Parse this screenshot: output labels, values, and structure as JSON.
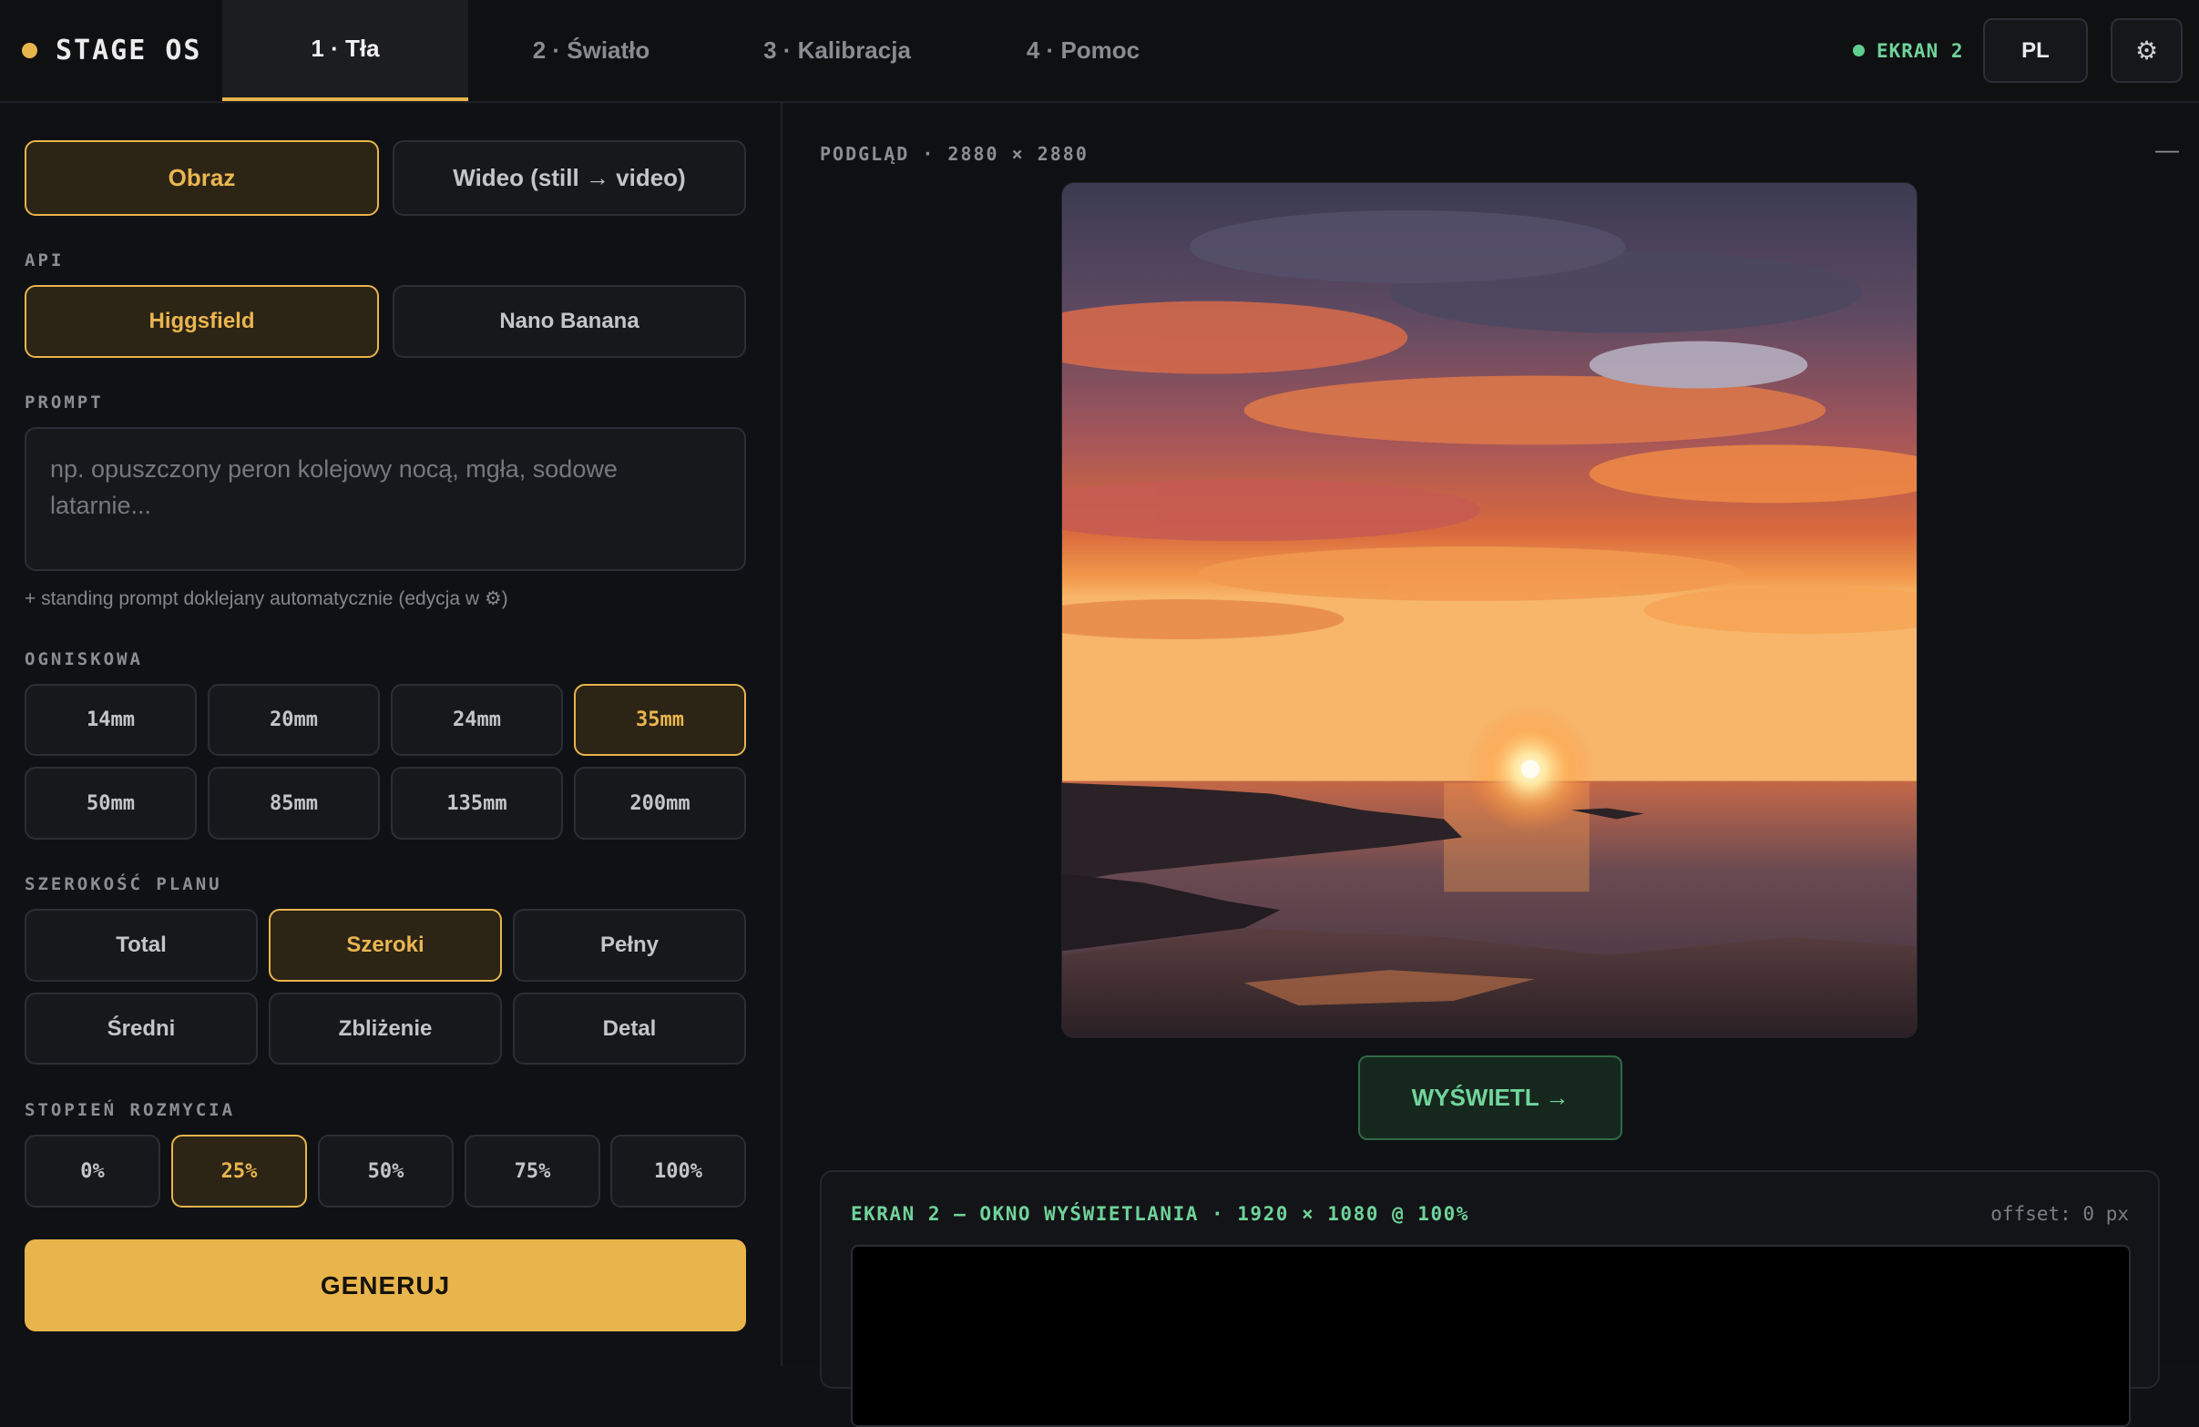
{
  "app": {
    "name": "STAGE OS"
  },
  "tabs": [
    {
      "label": "1 · Tła"
    },
    {
      "label": "2 · Światło"
    },
    {
      "label": "3 · Kalibracja"
    },
    {
      "label": "4 · Pomoc"
    }
  ],
  "status": {
    "screen_label": "EKRAN 2",
    "language": "PL"
  },
  "source": {
    "image_label": "Obraz",
    "video_label": "Wideo (still → video)",
    "selected": "Obraz"
  },
  "api": {
    "label": "API",
    "options": [
      "Higgsfield",
      "Nano Banana"
    ],
    "selected": "Higgsfield"
  },
  "prompt": {
    "label": "PROMPT",
    "placeholder": "np. opuszczony peron kolejowy nocą, mgła, sodowe latarnie...",
    "hint": "+ standing prompt doklejany automatycznie (edycja w ⚙)"
  },
  "focal": {
    "label": "OGNISKOWA",
    "options": [
      "14mm",
      "20mm",
      "24mm",
      "35mm",
      "50mm",
      "85mm",
      "135mm",
      "200mm"
    ],
    "selected": "35mm"
  },
  "shot_width": {
    "label": "SZEROKOŚĆ PLANU",
    "options": [
      "Total",
      "Szeroki",
      "Pełny",
      "Średni",
      "Zbliżenie",
      "Detal"
    ],
    "selected": "Szeroki"
  },
  "blur": {
    "label": "STOPIEŃ ROZMYCIA",
    "options": [
      "0%",
      "25%",
      "50%",
      "75%",
      "100%"
    ],
    "selected": "25%"
  },
  "generate": {
    "label": "GENERUJ"
  },
  "preview": {
    "label": "PODGLĄD · 2880 × 2880",
    "collapse_label": "—",
    "image_description_icon": "sunset-seascape-image"
  },
  "show_button": {
    "label": "WYŚWIETL →"
  },
  "screen_window": {
    "title": "EKRAN 2 — OKNO WYŚWIETLANIA · 1920 × 1080 @ 100%",
    "offset": "offset: 0 px"
  },
  "colors": {
    "accent": "#e8b44c",
    "success": "#6fd39a",
    "background": "#101114"
  }
}
